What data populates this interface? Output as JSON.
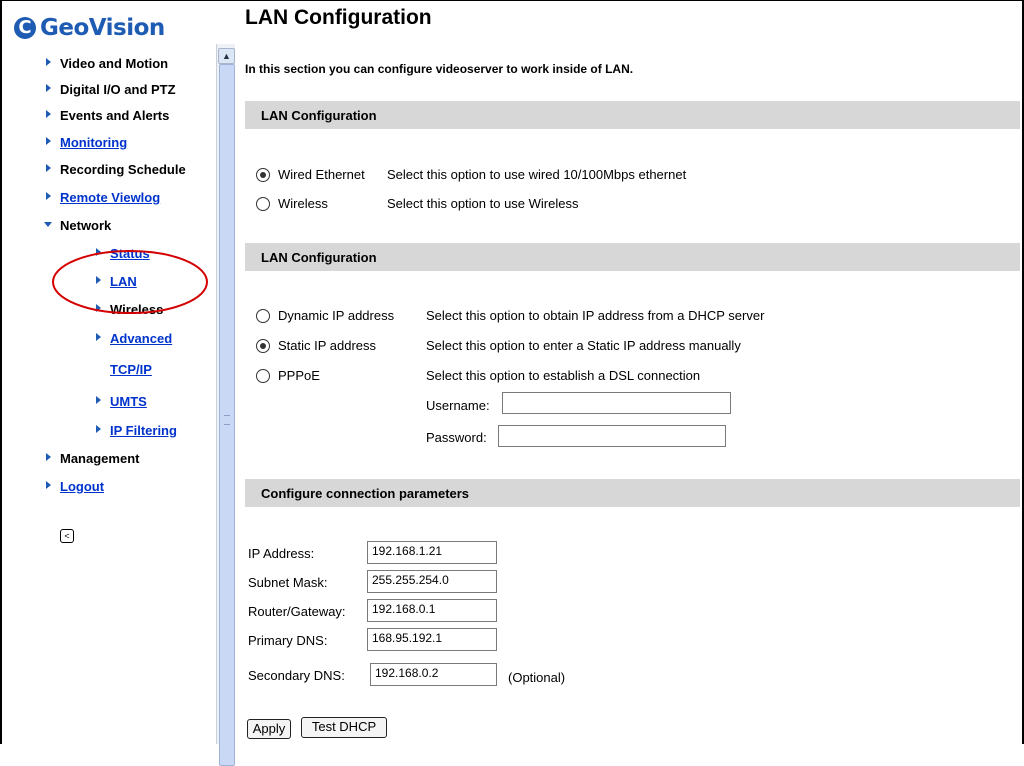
{
  "logo": {
    "mark": "C",
    "text": "GeoVision"
  },
  "sidebar": {
    "items": [
      {
        "label": "Video and Motion",
        "link": false
      },
      {
        "label": "Digital I/O and PTZ",
        "link": false
      },
      {
        "label": "Events and Alerts",
        "link": false
      },
      {
        "label": "Monitoring",
        "link": true
      },
      {
        "label": "Recording Schedule",
        "link": false
      },
      {
        "label": "Remote Viewlog",
        "link": true
      },
      {
        "label": "Network",
        "link": false,
        "expanded": true
      },
      {
        "label": "Management",
        "link": false
      },
      {
        "label": "Logout",
        "link": true
      }
    ],
    "network_subitems": [
      {
        "label": "Status",
        "link": true
      },
      {
        "label": "LAN",
        "link": true,
        "highlighted": true
      },
      {
        "label": "Wireless",
        "link": false
      },
      {
        "label": "Advanced",
        "link": true
      },
      {
        "label": "TCP/IP",
        "link": true
      },
      {
        "label": "UMTS",
        "link": true
      },
      {
        "label": "IP Filtering",
        "link": true
      }
    ],
    "collapse_icon": "collapse-left-icon",
    "highlight_color": "#d40000"
  },
  "main": {
    "title": "LAN Configuration",
    "intro": "In this section you can configure videoserver to work inside of LAN.",
    "section1": {
      "heading": "LAN Configuration",
      "options": [
        {
          "label": "Wired Ethernet",
          "description": "Select this option to use wired 10/100Mbps ethernet",
          "checked": true
        },
        {
          "label": "Wireless",
          "description": "Select this option to use Wireless",
          "checked": false
        }
      ]
    },
    "section2": {
      "heading": "LAN Configuration",
      "options": [
        {
          "label": "Dynamic IP address",
          "description": "Select this option to obtain IP address from a DHCP server",
          "checked": false
        },
        {
          "label": "Static IP address",
          "description": "Select this option to enter a Static IP address manually",
          "checked": true
        },
        {
          "label": "PPPoE",
          "description": "Select this option to establish a DSL connection",
          "checked": false
        }
      ],
      "username_label": "Username:",
      "username_value": "",
      "password_label": "Password:",
      "password_value": ""
    },
    "section3": {
      "heading": "Configure connection parameters",
      "ip_label": "IP Address:",
      "ip_value": "192.168.1.21",
      "subnet_label": "Subnet Mask:",
      "subnet_value": "255.255.254.0",
      "gateway_label": "Router/Gateway:",
      "gateway_value": "192.168.0.1",
      "dns1_label": "Primary DNS:",
      "dns1_value": "168.95.192.1",
      "dns2_label": "Secondary DNS:",
      "dns2_value": "192.168.0.2",
      "optional_note": "(Optional)"
    },
    "buttons": {
      "apply": "Apply",
      "test_dhcp": "Test DHCP"
    }
  },
  "colors": {
    "brand": "#1e5bb3",
    "link": "#0033cc",
    "section_bg": "#d7d7d7"
  }
}
